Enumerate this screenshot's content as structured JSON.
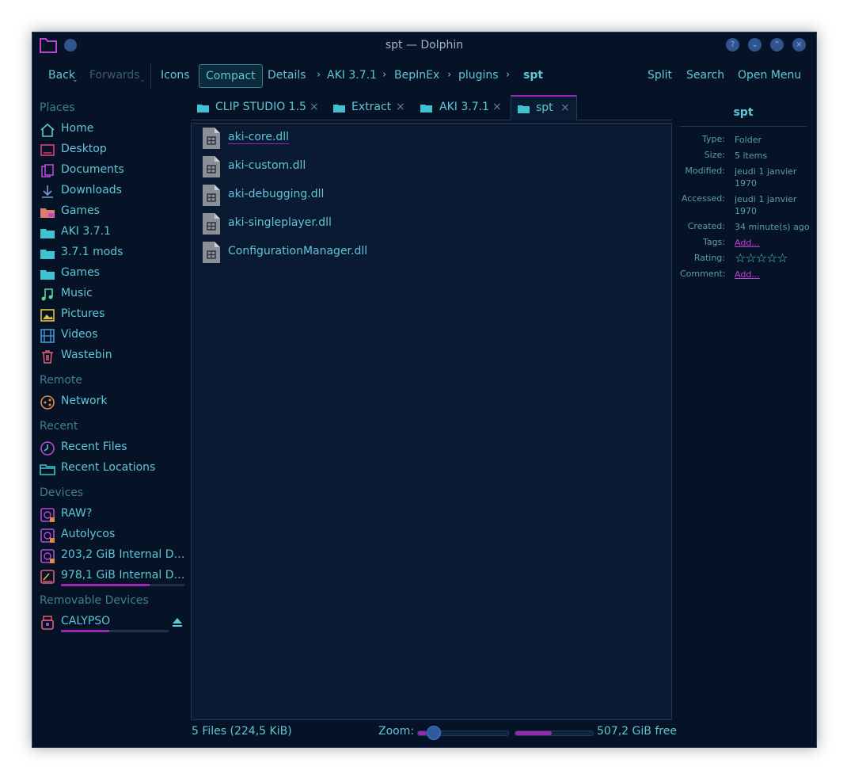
{
  "window": {
    "title": "spt — Dolphin"
  },
  "toolbar": {
    "back": "Back",
    "forwards": "Forwards",
    "icons": "Icons",
    "compact": "Compact",
    "details": "Details",
    "breadcrumb": [
      "AKI 3.7.1",
      "BepInEx",
      "plugins",
      "spt"
    ],
    "split": "Split",
    "search": "Search",
    "open_menu": "Open Menu"
  },
  "places": {
    "places_header": "Places",
    "items": [
      {
        "label": "Home",
        "icon": "home-icon"
      },
      {
        "label": "Desktop",
        "icon": "desktop-icon"
      },
      {
        "label": "Documents",
        "icon": "documents-icon"
      },
      {
        "label": "Downloads",
        "icon": "downloads-icon"
      },
      {
        "label": "Games",
        "icon": "games-folder-icon"
      },
      {
        "label": "AKI 3.7.1",
        "icon": "folder-icon"
      },
      {
        "label": "3.7.1 mods",
        "icon": "folder-icon"
      },
      {
        "label": "Games",
        "icon": "folder-icon"
      },
      {
        "label": "Music",
        "icon": "music-icon"
      },
      {
        "label": "Pictures",
        "icon": "pictures-icon"
      },
      {
        "label": "Videos",
        "icon": "videos-icon"
      },
      {
        "label": "Wastebin",
        "icon": "trash-icon"
      }
    ],
    "remote_header": "Remote",
    "remote": [
      {
        "label": "Network",
        "icon": "network-icon"
      }
    ],
    "recent_header": "Recent",
    "recent": [
      {
        "label": "Recent Files",
        "icon": "recent-files-icon"
      },
      {
        "label": "Recent Locations",
        "icon": "recent-locations-icon"
      }
    ],
    "devices_header": "Devices",
    "devices": [
      {
        "label": "RAW?",
        "icon": "drive-icon"
      },
      {
        "label": "Autolycos",
        "icon": "drive-icon"
      },
      {
        "label": "203,2 GiB Internal Dri...",
        "icon": "drive-icon"
      },
      {
        "label": "978,1 GiB Internal Dri...",
        "icon": "ssd-icon",
        "usage": 0.72
      }
    ],
    "removable_header": "Removable Devices",
    "removable": [
      {
        "label": "CALYPSO",
        "icon": "usb-icon",
        "usage": 0.45
      }
    ]
  },
  "tabs": [
    {
      "label": "CLIP STUDIO 1.5"
    },
    {
      "label": "Extract"
    },
    {
      "label": "AKI 3.7.1"
    },
    {
      "label": "spt"
    }
  ],
  "files": [
    {
      "name": "aki-core.dll"
    },
    {
      "name": "aki-custom.dll"
    },
    {
      "name": "aki-debugging.dll"
    },
    {
      "name": "aki-singleplayer.dll"
    },
    {
      "name": "ConfigurationManager.dll"
    }
  ],
  "info": {
    "name": "spt",
    "type_label": "Type:",
    "type": "Folder",
    "size_label": "Size:",
    "size": "5 items",
    "modified_label": "Modified:",
    "modified": "jeudi 1 janvier 1970",
    "accessed_label": "Accessed:",
    "accessed": "jeudi 1 janvier 1970",
    "created_label": "Created:",
    "created": "34 minute(s) ago",
    "tags_label": "Tags:",
    "tags": "Add...",
    "rating_label": "Rating:",
    "rating": 0,
    "comment_label": "Comment:",
    "comment": "Add..."
  },
  "status": {
    "count": "5 Files (224,5 KiB)",
    "zoom_label": "Zoom:",
    "zoom_level": 0.1,
    "free": "507,2 GiB free",
    "disk_used": 0.47
  },
  "colors": {
    "accent": "#9a27b3",
    "text": "#5fc6d6",
    "background": "#061326"
  }
}
